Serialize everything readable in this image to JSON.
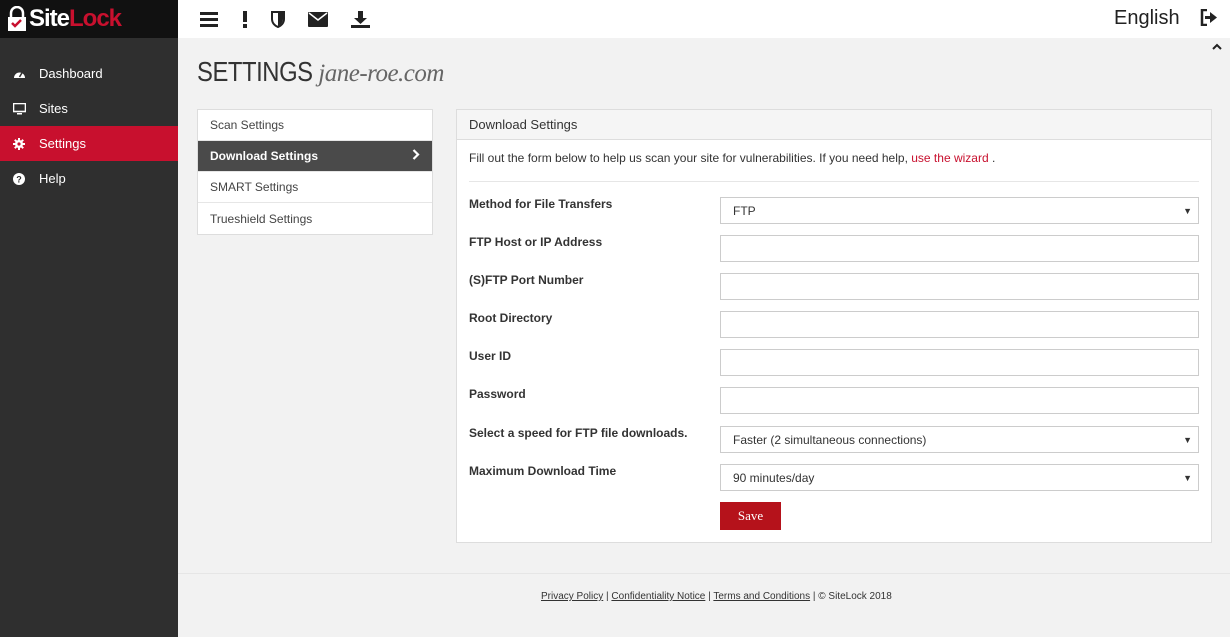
{
  "brand": {
    "logo_site": "Site",
    "logo_lock": "Lock",
    "accent": "#c8102e"
  },
  "sidebar": {
    "items": [
      {
        "label": "Dashboard",
        "icon": "dashboard-icon"
      },
      {
        "label": "Sites",
        "icon": "monitor-icon"
      },
      {
        "label": "Settings",
        "icon": "gear-icon",
        "active": true
      },
      {
        "label": "Help",
        "icon": "question-icon"
      }
    ]
  },
  "topbar": {
    "icons": [
      "menu-icon",
      "alert-icon",
      "shield-icon",
      "envelope-icon",
      "download-icon"
    ],
    "language": "English"
  },
  "page": {
    "title": "SETTINGS",
    "domain": "jane-roe.com"
  },
  "submenu": {
    "items": [
      {
        "label": "Scan Settings"
      },
      {
        "label": "Download Settings",
        "active": true
      },
      {
        "label": "SMART Settings"
      },
      {
        "label": "Trueshield Settings"
      }
    ]
  },
  "panel": {
    "title": "Download Settings",
    "intro": "Fill out the form below to help us scan your site for vulnerabilities. If you need help,",
    "intro_link": "use the wizard",
    "intro_end": " .",
    "fields": [
      {
        "label": "Method for File Transfers",
        "type": "select",
        "value": "FTP"
      },
      {
        "label": "FTP Host or IP Address",
        "type": "text",
        "value": ""
      },
      {
        "label": "(S)FTP Port Number",
        "type": "text",
        "value": ""
      },
      {
        "label": "Root Directory",
        "type": "text",
        "value": ""
      },
      {
        "label": "User ID",
        "type": "text",
        "value": ""
      },
      {
        "label": "Password",
        "type": "password",
        "value": ""
      },
      {
        "label": "Select a speed for FTP file downloads.",
        "type": "select",
        "value": "Faster (2 simultaneous connections)"
      },
      {
        "label": "Maximum Download Time",
        "type": "select",
        "value": "90 minutes/day"
      }
    ],
    "save_label": "Save"
  },
  "footer": {
    "privacy": "Privacy Policy",
    "confidentiality": "Confidentiality Notice",
    "terms": "Terms and Conditions",
    "sep": "|",
    "copyright": "© SiteLock 2018"
  }
}
